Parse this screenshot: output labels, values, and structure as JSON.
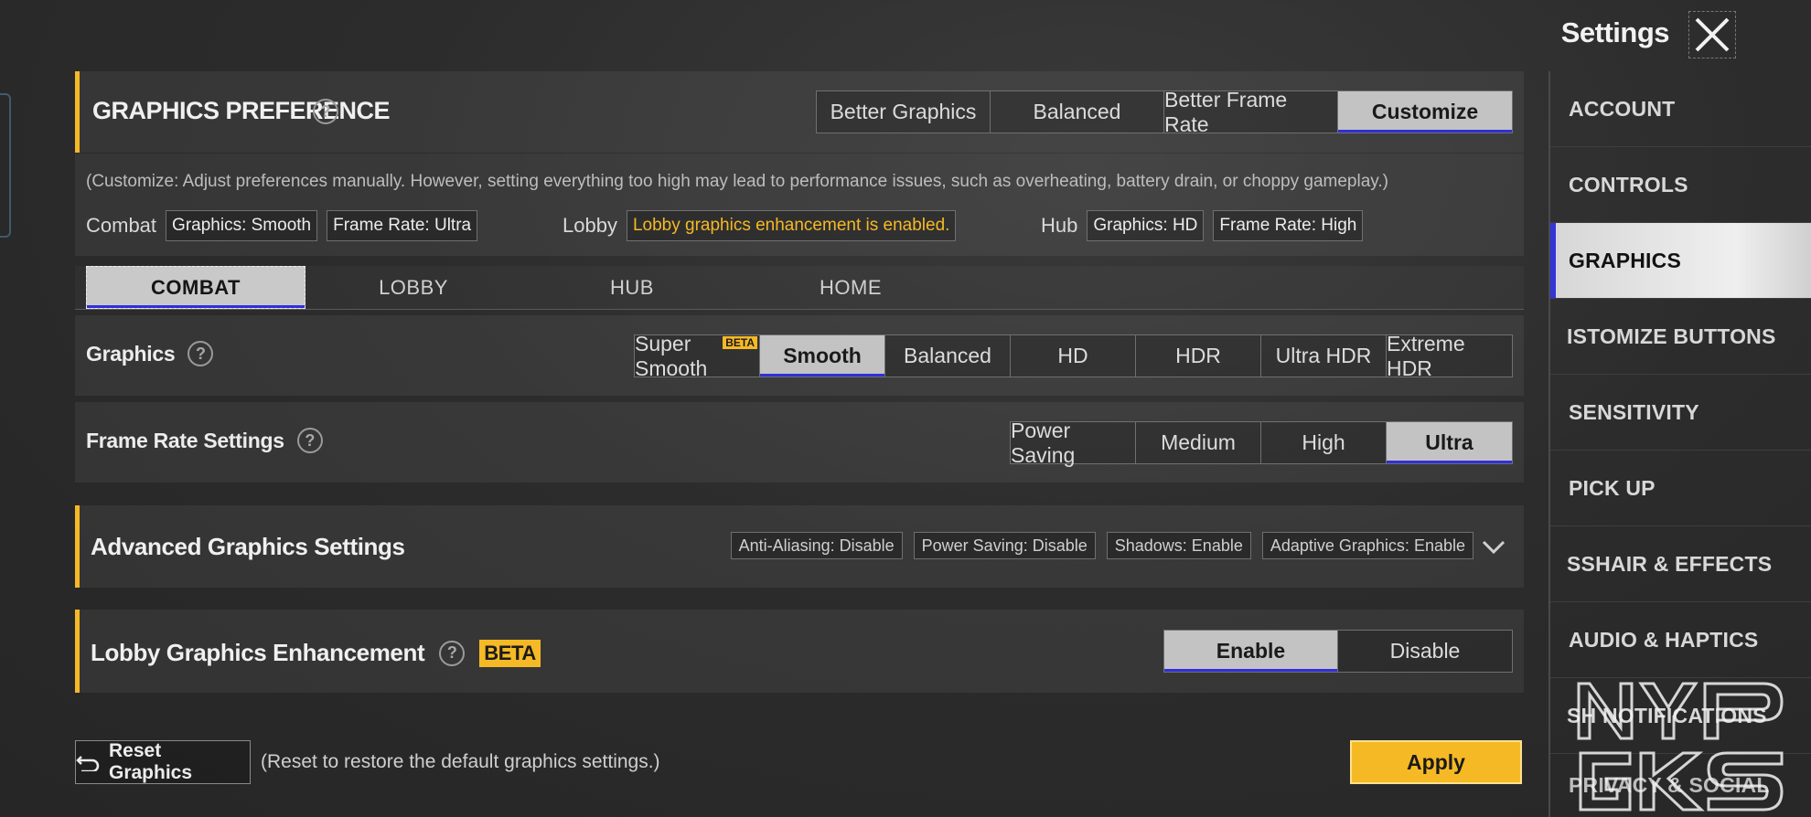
{
  "header": {
    "title": "Settings",
    "close_icon": "close-icon"
  },
  "graphics_preference": {
    "title": "GRAPHICS PREFERENCE",
    "help_icon": "?",
    "options": [
      "Better Graphics",
      "Balanced",
      "Better Frame Rate",
      "Customize"
    ],
    "selected": "Customize"
  },
  "info": {
    "note": "(Customize: Adjust preferences manually. However, setting everything too high may lead to performance issues, such as overheating, battery drain, or choppy gameplay.)",
    "combat_label": "Combat",
    "combat_graphics": "Graphics: Smooth",
    "combat_frame_rate": "Frame Rate: Ultra",
    "lobby_label": "Lobby",
    "lobby_status": "Lobby graphics enhancement is enabled.",
    "hub_label": "Hub",
    "hub_graphics": "Graphics: HD",
    "hub_frame_rate": "Frame Rate: High"
  },
  "mode_tabs": [
    "COMBAT",
    "LOBBY",
    "HUB",
    "HOME"
  ],
  "graphics": {
    "label": "Graphics",
    "help_icon": "?",
    "options": [
      "Super Smooth",
      "Smooth",
      "Balanced",
      "HD",
      "HDR",
      "Ultra HDR",
      "Extreme HDR"
    ],
    "beta_tag": "BETA",
    "selected": "Smooth"
  },
  "frame_rate": {
    "label": "Frame Rate Settings",
    "help_icon": "?",
    "options": [
      "Power Saving",
      "Medium",
      "High",
      "Ultra"
    ],
    "selected": "Ultra"
  },
  "advanced": {
    "title": "Advanced Graphics Settings",
    "chips": [
      "Anti-Aliasing: Disable",
      "Power Saving: Disable",
      "Shadows: Enable",
      "Adaptive Graphics: Enable"
    ]
  },
  "lobby_enhancement": {
    "label": "Lobby Graphics Enhancement",
    "help_icon": "?",
    "beta": "BETA",
    "options": [
      "Enable",
      "Disable"
    ],
    "selected": "Enable"
  },
  "footer": {
    "reset_label": "Reset Graphics",
    "reset_note": "(Reset to restore the default graphics settings.)",
    "apply_label": "Apply"
  },
  "sidebar": {
    "items": [
      "ACCOUNT",
      "CONTROLS",
      "GRAPHICS",
      "ISTOMIZE BUTTONS",
      "SENSITIVITY",
      "PICK UP",
      "SSHAIR & EFFECTS",
      "AUDIO & HAPTICS",
      "SH NOTIFICATIONS",
      "PRIVACY & SOCIAL"
    ],
    "active": "GRAPHICS"
  },
  "watermark": [
    "NYP",
    "GKS"
  ],
  "colors": {
    "accent": "#f5b926",
    "selection_underline": "#2f2fd8",
    "background": "#2c2c2c"
  }
}
